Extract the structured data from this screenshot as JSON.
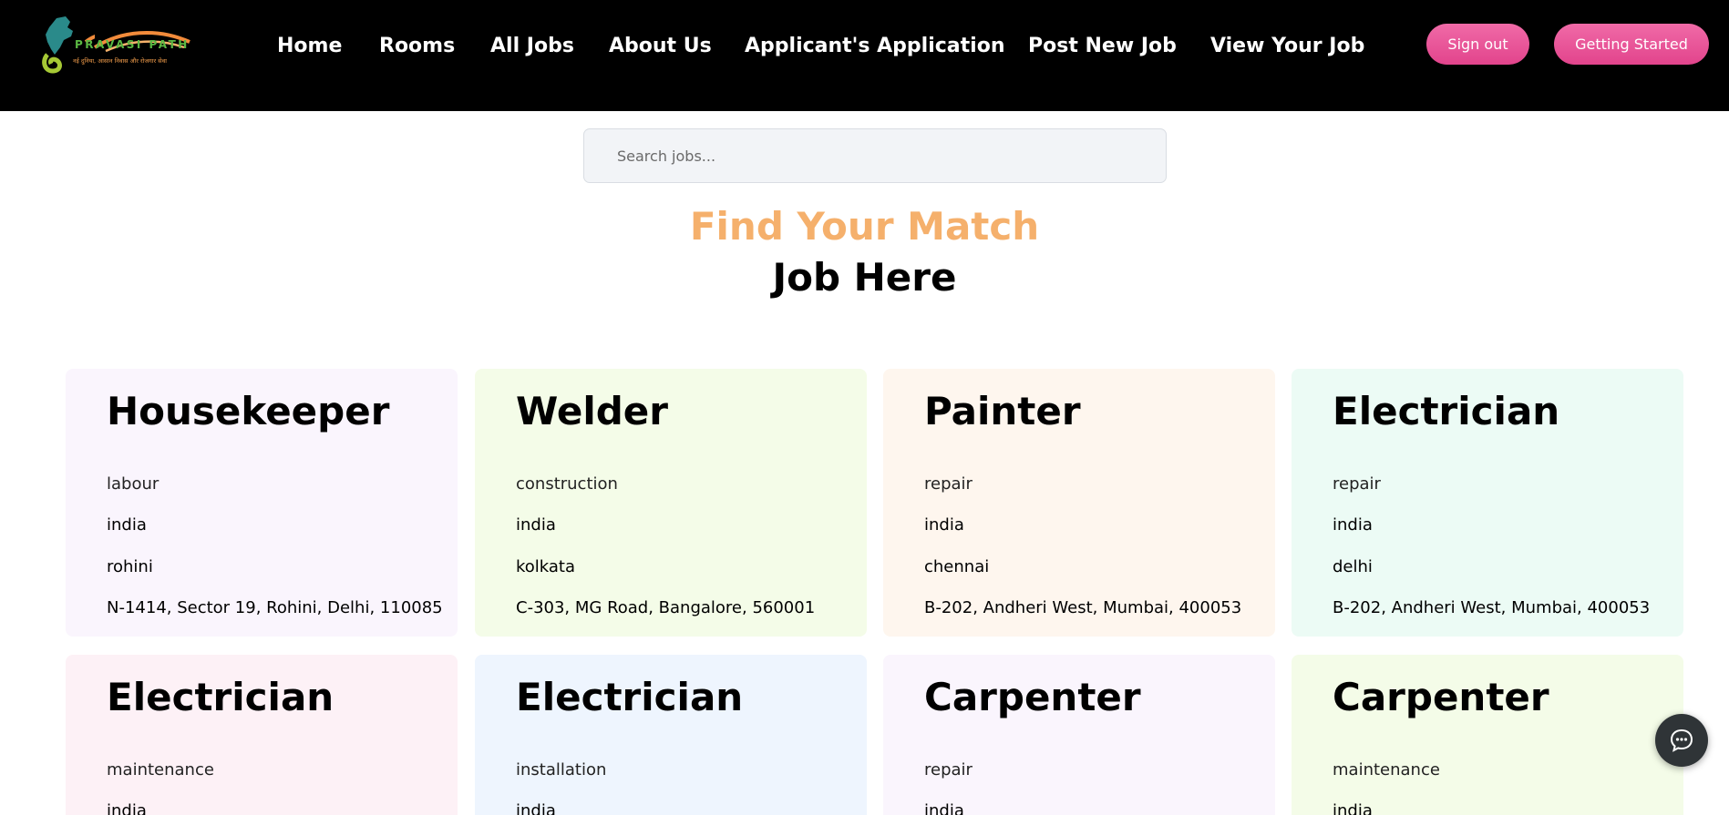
{
  "brand": {
    "name": "PRAVASI PATH",
    "tagline": "नई दुनिया, आसान निवास और रोजगार सेवा"
  },
  "nav": {
    "items": [
      {
        "label": "Home"
      },
      {
        "label": "Rooms"
      },
      {
        "label": "All Jobs"
      },
      {
        "label": "About Us"
      },
      {
        "label": "Applicant's Application"
      },
      {
        "label": "Post New Job"
      },
      {
        "label": "View Your Job"
      }
    ],
    "sign_out": "Sign out",
    "getting_started": "Getting Started"
  },
  "search": {
    "placeholder": "Search jobs...",
    "value": ""
  },
  "hero": {
    "line1": "Find Your Match",
    "line2": "Job Here"
  },
  "jobs": [
    {
      "title": "Housekeeper",
      "category": "labour",
      "country": "india",
      "city": "rohini",
      "address": "N-1414, Sector 19, Rohini, Delhi, 110085",
      "bg": "#faf5fd"
    },
    {
      "title": "Welder",
      "category": "construction",
      "country": "india",
      "city": "kolkata",
      "address": "C-303, MG Road, Bangalore, 560001",
      "bg": "#f4fce8"
    },
    {
      "title": "Painter",
      "category": "repair",
      "country": "india",
      "city": "chennai",
      "address": "B-202, Andheri West, Mumbai, 400053",
      "bg": "#fef6ee"
    },
    {
      "title": "Electrician",
      "category": "repair",
      "country": "india",
      "city": "delhi",
      "address": "B-202, Andheri West, Mumbai, 400053",
      "bg": "#ecfbf5"
    },
    {
      "title": "Electrician",
      "category": "maintenance",
      "country": "india",
      "city": "",
      "address": "",
      "bg": "#fdf1f6"
    },
    {
      "title": "Electrician",
      "category": "installation",
      "country": "india",
      "city": "",
      "address": "",
      "bg": "#eef5fe"
    },
    {
      "title": "Carpenter",
      "category": "repair",
      "country": "india",
      "city": "",
      "address": "",
      "bg": "#faf5fd"
    },
    {
      "title": "Carpenter",
      "category": "maintenance",
      "country": "india",
      "city": "",
      "address": "",
      "bg": "#f4fce8"
    }
  ],
  "icons": {
    "logo": "india-map-logo-icon",
    "chat": "chat-bubble-icon"
  }
}
